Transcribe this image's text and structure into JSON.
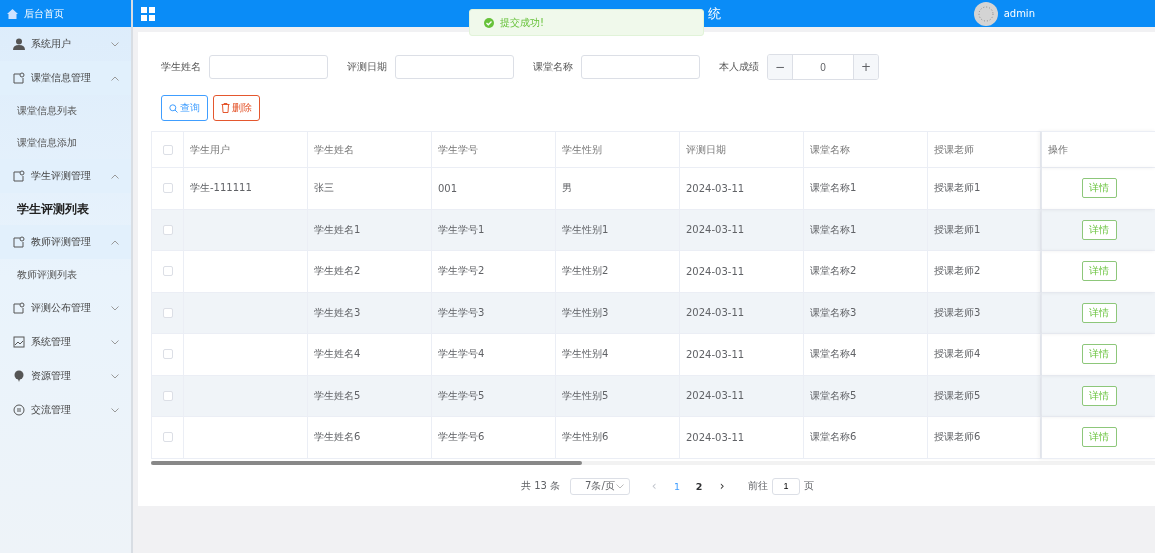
{
  "header": {
    "title": "统",
    "user": "admin"
  },
  "toast": {
    "kind": "success",
    "text": "提交成功!"
  },
  "sidebar": {
    "home": "后台首页",
    "items": [
      {
        "label": "系统用户",
        "expanded": false
      },
      {
        "label": "课堂信息管理",
        "expanded": true,
        "children": [
          {
            "label": "课堂信息列表",
            "selected": false
          },
          {
            "label": "课堂信息添加",
            "selected": false
          }
        ]
      },
      {
        "label": "学生评测管理",
        "expanded": true,
        "children": [
          {
            "label": "学生评测列表",
            "selected": true
          }
        ]
      },
      {
        "label": "教师评测管理",
        "expanded": true,
        "children": [
          {
            "label": "教师评测列表",
            "selected": false
          }
        ]
      },
      {
        "label": "评测公布管理",
        "expanded": false
      },
      {
        "label": "系统管理",
        "expanded": false
      },
      {
        "label": "资源管理",
        "expanded": false
      },
      {
        "label": "交流管理",
        "expanded": false
      }
    ]
  },
  "filters": [
    {
      "kind": "text",
      "label": "学生姓名"
    },
    {
      "kind": "text",
      "label": "评测日期"
    },
    {
      "kind": "text",
      "label": "课堂名称"
    },
    {
      "kind": "number",
      "label": "本人成绩",
      "value": "0",
      "minus": "−",
      "plus": "+"
    }
  ],
  "buttons": [
    {
      "kind": "search",
      "label": "查询"
    },
    {
      "kind": "delete",
      "label": "删除"
    }
  ],
  "table": {
    "select_all": false,
    "columns": [
      "学生用户",
      "学生姓名",
      "学生学号",
      "学生性别",
      "评测日期",
      "课堂名称",
      "授课老师",
      "操作"
    ],
    "rows": [
      {
        "checked": false,
        "cells": [
          "学生-111111",
          "张三",
          "001",
          "男",
          "2024-03-11",
          "课堂名称1",
          "授课老师1"
        ],
        "action": "详情"
      },
      {
        "checked": false,
        "cells": [
          "",
          "学生姓名1",
          "学生学号1",
          "学生性别1",
          "2024-03-11",
          "课堂名称1",
          "授课老师1"
        ],
        "action": "详情"
      },
      {
        "checked": false,
        "cells": [
          "",
          "学生姓名2",
          "学生学号2",
          "学生性别2",
          "2024-03-11",
          "课堂名称2",
          "授课老师2"
        ],
        "action": "详情"
      },
      {
        "checked": false,
        "cells": [
          "",
          "学生姓名3",
          "学生学号3",
          "学生性别3",
          "2024-03-11",
          "课堂名称3",
          "授课老师3"
        ],
        "action": "详情"
      },
      {
        "checked": false,
        "cells": [
          "",
          "学生姓名4",
          "学生学号4",
          "学生性别4",
          "2024-03-11",
          "课堂名称4",
          "授课老师4"
        ],
        "action": "详情"
      },
      {
        "checked": false,
        "cells": [
          "",
          "学生姓名5",
          "学生学号5",
          "学生性别5",
          "2024-03-11",
          "课堂名称5",
          "授课老师5"
        ],
        "action": "详情"
      },
      {
        "checked": false,
        "cells": [
          "",
          "学生姓名6",
          "学生学号6",
          "学生性别6",
          "2024-03-11",
          "课堂名称6",
          "授课老师6"
        ],
        "action": "详情"
      }
    ]
  },
  "pagination": {
    "total": "共 13 条",
    "page_size": "7条/页",
    "prev": "‹",
    "pages": [
      {
        "label": "1",
        "selected": true
      },
      {
        "label": "2",
        "selected": false
      }
    ],
    "next": "›",
    "goto_label": "前往",
    "goto_value": "1",
    "goto_suffix": "页"
  }
}
